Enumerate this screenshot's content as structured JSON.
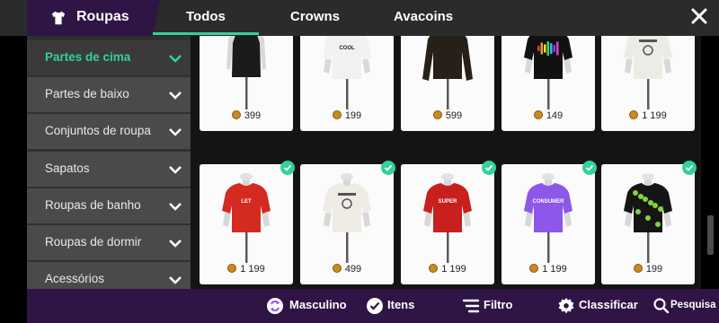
{
  "header": {
    "title": "Roupas",
    "tabs": [
      {
        "label": "Todos",
        "active": true
      },
      {
        "label": "Crowns",
        "active": false
      },
      {
        "label": "Avacoins",
        "active": false
      }
    ],
    "accent": "#34d19a",
    "close_icon": "close-icon"
  },
  "sidebar": {
    "categories": [
      {
        "label": "Partes de cima",
        "active": true
      },
      {
        "label": "Partes de baixo",
        "active": false
      },
      {
        "label": "Conjuntos de roupa",
        "active": false
      },
      {
        "label": "Sapatos",
        "active": false
      },
      {
        "label": "Roupas de banho",
        "active": false
      },
      {
        "label": "Roupas de dormir",
        "active": false
      },
      {
        "label": "Acessórios",
        "active": false
      }
    ]
  },
  "items": [
    {
      "price": "399",
      "owned": true,
      "shirt_color": "#1b1b1b",
      "style": "tank",
      "print": ""
    },
    {
      "price": "199",
      "owned": true,
      "shirt_color": "#f1f1f1",
      "style": "tee",
      "print": "COOL STORY BRO"
    },
    {
      "price": "599",
      "owned": true,
      "shirt_color": "#262018",
      "style": "longsleeve",
      "print": ""
    },
    {
      "price": "149",
      "owned": true,
      "shirt_color": "#111111",
      "style": "tee",
      "print": "equalizer"
    },
    {
      "price": "1 199",
      "owned": true,
      "shirt_color": "#ecebe6",
      "style": "tee",
      "print": "hands"
    },
    {
      "price": "1 199",
      "owned": true,
      "shirt_color": "#d52a20",
      "style": "tee",
      "print": "LET ME?"
    },
    {
      "price": "499",
      "owned": true,
      "shirt_color": "#efece6",
      "style": "tee",
      "print": "small"
    },
    {
      "price": "1 199",
      "owned": true,
      "shirt_color": "#c8201f",
      "style": "tee",
      "print": "SUPER"
    },
    {
      "price": "1 199",
      "owned": true,
      "shirt_color": "#8d57e8",
      "style": "tee",
      "print": "CONSUMER"
    },
    {
      "price": "199",
      "owned": true,
      "shirt_color": "#151515",
      "style": "tee",
      "print": "leaves"
    }
  ],
  "bottom_bar": {
    "gender_label": "Masculino",
    "items_label": "Itens",
    "filter_label": "Filtro",
    "sort_label": "Classificar",
    "search_label": "Pesquisa"
  }
}
